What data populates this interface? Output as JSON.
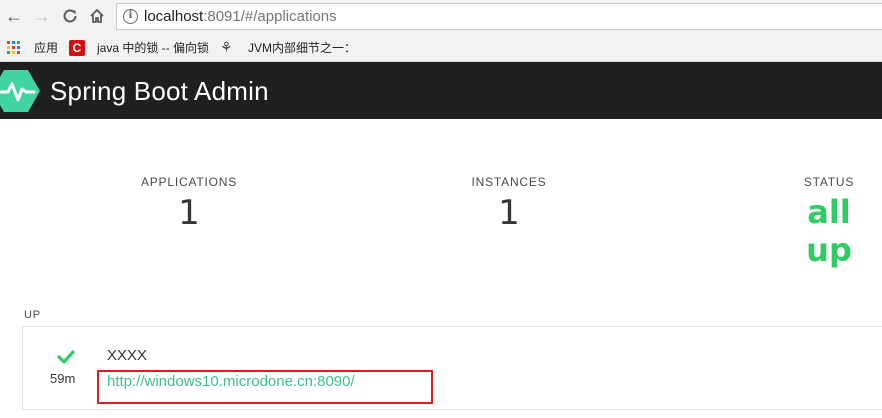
{
  "browser": {
    "url_host": "localhost",
    "url_rest": ":8091/#/applications",
    "bookmarks": [
      {
        "label": "应用"
      },
      {
        "label": "java 中的锁 -- 偏向锁"
      },
      {
        "label": "JVM内部细节之一："
      }
    ]
  },
  "header": {
    "title": "Spring Boot Admin",
    "accent": "#42d3a5"
  },
  "stats": {
    "applications": {
      "label": "APPLICATIONS",
      "value": "1"
    },
    "instances": {
      "label": "INSTANCES",
      "value": "1"
    },
    "status": {
      "label": "STATUS",
      "value": "all up",
      "color": "#2ecc62"
    }
  },
  "groups": [
    {
      "label": "UP",
      "apps": [
        {
          "name": "XXXX",
          "url": "http://windows10.microdone.cn:8090/",
          "uptime": "59m",
          "status_icon": "check-icon"
        }
      ]
    }
  ]
}
